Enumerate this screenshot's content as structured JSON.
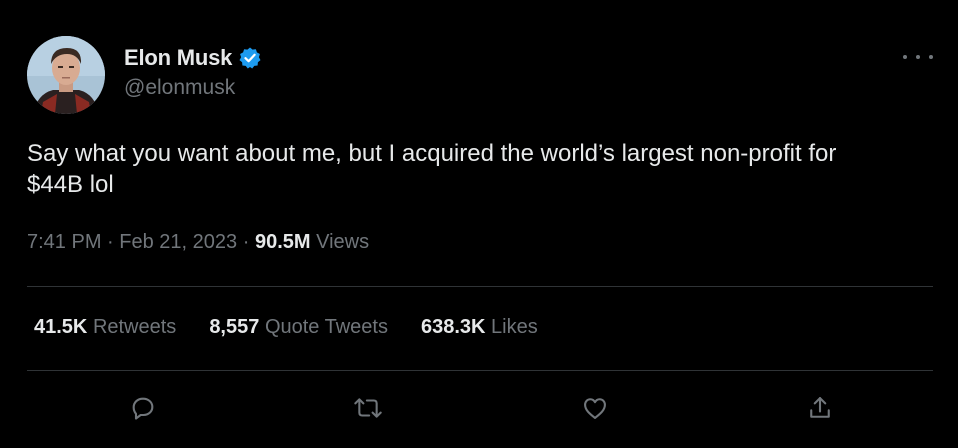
{
  "author": {
    "display_name": "Elon Musk",
    "handle": "@elonmusk",
    "verified": true,
    "verified_color": "#1d9bf0",
    "avatar_icon": "profile-photo"
  },
  "tweet": {
    "text": "Say what you want about me, but I acquired the world’s largest non-profit for $44B lol",
    "time": "7:41 PM",
    "date": "Feb 21, 2023",
    "separator": "·",
    "views_count": "90.5M",
    "views_label": "Views"
  },
  "stats": {
    "retweets_count": "41.5K",
    "retweets_label": "Retweets",
    "quotes_count": "8,557",
    "quotes_label": "Quote Tweets",
    "likes_count": "638.3K",
    "likes_label": "Likes"
  },
  "actions": [
    "reply-icon",
    "retweet-icon",
    "like-icon",
    "share-icon"
  ],
  "theme": {
    "background": "#000000",
    "text": "#e7e9ea",
    "muted": "#71767b",
    "divider": "#2f3336"
  }
}
